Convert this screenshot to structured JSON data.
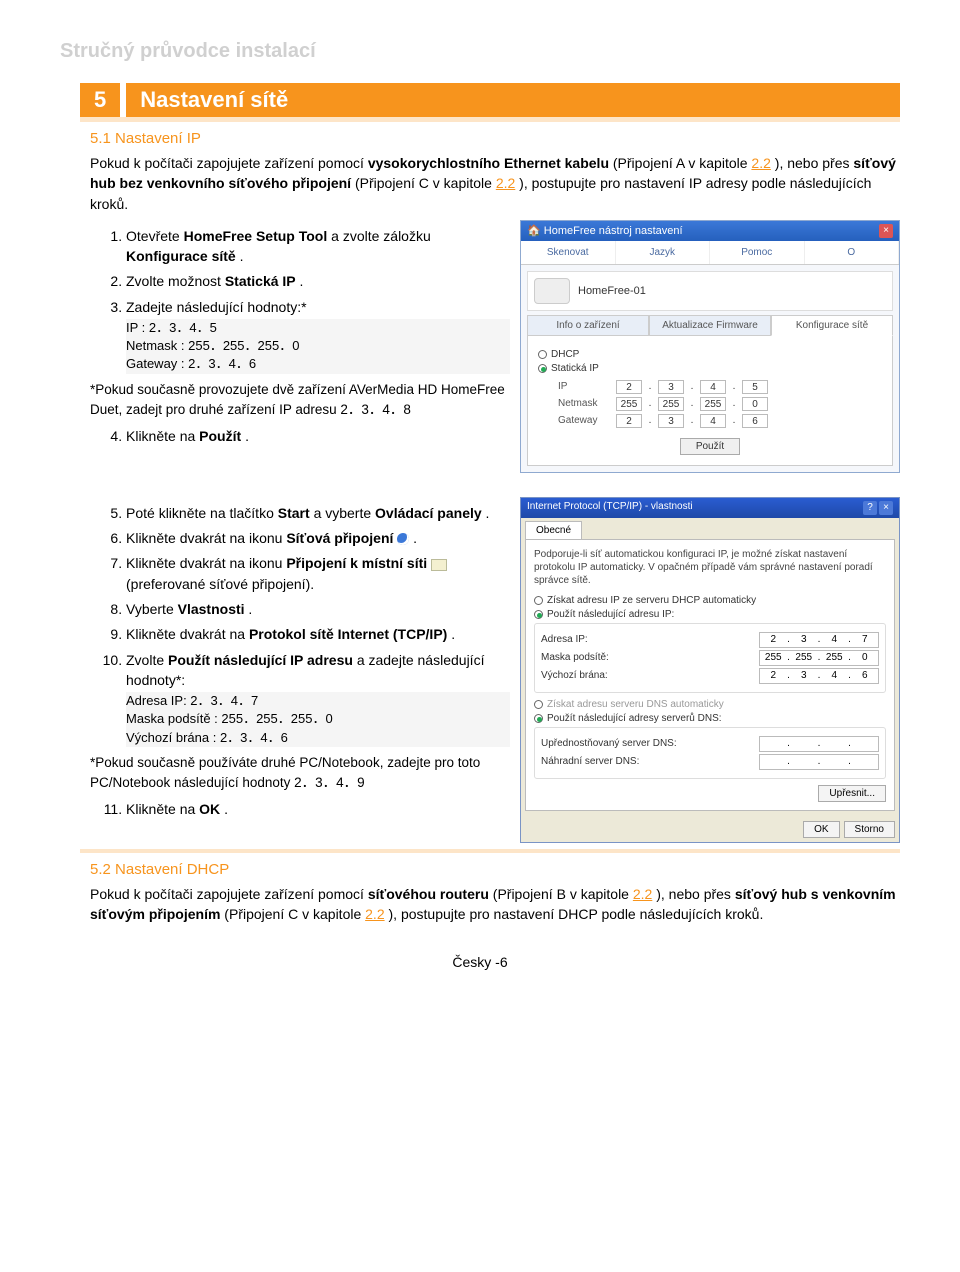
{
  "doc_title": "Stručný průvodce instalací",
  "section": {
    "num": "5",
    "title": "Nastavení sítě"
  },
  "sub_51": "5.1 Nastavení IP",
  "intro_51": {
    "p1a": "Pokud k počítači zapojujete zařízení pomocí ",
    "p1b": "vysokorychlostního Ethernet kabelu",
    "p1c": " (Připojení A v kapitole ",
    "link1": "2.2",
    "p1d": "), nebo přes ",
    "p1e": "síťový hub bez venkovního síťového připojení",
    "p1f": " (Připojení C v kapitole ",
    "link2": "2.2",
    "p1g": "), postupujte pro nastavení IP adresy podle následujících kroků."
  },
  "steps_a": {
    "s1a": "Otevřete ",
    "s1b": "HomeFree Setup Tool",
    "s1c": " a zvolte záložku ",
    "s1d": "Konfigurace sítě",
    "s1e": ".",
    "s2a": "Zvolte možnost ",
    "s2b": "Statická IP",
    "s2c": ".",
    "s3": "Zadejte následující hodnoty:*",
    "code1_l1": "IP : 2．3．4．5",
    "code1_l2": "Netmask : 255．255．255．0",
    "code1_l3": "Gateway : 2．3．4．6",
    "note1": "*Pokud současně provozujete dvě zařízení AVerMedia HD HomeFree Duet, zadejt pro druhé zařízení IP adresu 2．3．4．8",
    "s4a": "Klikněte na ",
    "s4b": "Použít",
    "s4c": "."
  },
  "steps_b": {
    "s5a": "Poté klikněte na tlačítko ",
    "s5b": "Start",
    "s5c": " a vyberte ",
    "s5d": "Ovládací panely",
    "s5e": ".",
    "s6a": "Klikněte dvakrát na ikonu ",
    "s6b": "Síťová připojení",
    "s6c": ".",
    "s7a": "Klikněte dvakrát na ikonu ",
    "s7b": "Připojení k místní síti",
    "s7c": " (preferované síťové připojení).",
    "s8a": "Vyberte ",
    "s8b": "Vlastnosti",
    "s8c": ".",
    "s9a": "Klikněte dvakrát na ",
    "s9b": "Protokol sítě Internet (TCP/IP)",
    "s9c": ".",
    "s10a": "Zvolte ",
    "s10b": "Použít následující IP adresu",
    "s10c": " a zadejte následující hodnoty*:",
    "code2_l1": "Adresa IP: 2．3．4．7",
    "code2_l2": "Maska podsítě : 255．255．255．0",
    "code2_l3": "Výchozí brána : 2．3．4．6",
    "note2": "*Pokud současně používáte druhé PC/Notebook, zadejte pro toto PC/Notebook následující hodnoty 2．3．4．9",
    "s11a": "Klikněte na ",
    "s11b": "OK",
    "s11c": "."
  },
  "sub_52": "5.2 Nastavení DHCP",
  "intro_52": {
    "t1": "Pokud k počítači zapojujete zařízení pomocí ",
    "t2": "síťovéhou routeru",
    "t3": " (Připojení B v kapitole ",
    "link3": "2.2",
    "t4": "), nebo přes ",
    "t5": "síťový hub s venkovním síťovým připojením",
    "t6": " (Připojení C v kapitole ",
    "link4": "2.2",
    "t7": "), postupujte pro nastavení DHCP podle následujících kroků."
  },
  "footer": "Česky -6",
  "shot1": {
    "title": "HomeFree nástroj nastavení",
    "tabs": [
      "Skenovat",
      "Jazyk",
      "Pomoc",
      "O"
    ],
    "device": "HomeFree-01",
    "subtabs": [
      "Info o zařízení",
      "Aktualizace Firmware",
      "Konfigurace sítě"
    ],
    "r_dhcp": "DHCP",
    "r_static": "Statická IP",
    "lbl_ip": "IP",
    "lbl_nm": "Netmask",
    "lbl_gw": "Gateway",
    "ip": [
      "2",
      "3",
      "4",
      "5"
    ],
    "nm": [
      "255",
      "255",
      "255",
      "0"
    ],
    "gw": [
      "2",
      "3",
      "4",
      "6"
    ],
    "apply": "Použít"
  },
  "shot2": {
    "title": "Internet Protocol (TCP/IP) - vlastnosti",
    "tab": "Obecné",
    "desc": "Podporuje-li síť automatickou konfiguraci IP, je možné získat nastavení protokolu IP automaticky. V opačném případě vám správné nastavení poradí správce sítě.",
    "r1": "Získat adresu IP ze serveru DHCP automaticky",
    "r2": "Použít následující adresu IP:",
    "lbl_ip": "Adresa IP:",
    "lbl_mask": "Maska podsítě:",
    "lbl_gw": "Výchozí brána:",
    "ip": [
      "2",
      "3",
      "4",
      "7"
    ],
    "mask": [
      "255",
      "255",
      "255",
      "0"
    ],
    "gw": [
      "2",
      "3",
      "4",
      "6"
    ],
    "r3": "Získat adresu serveru DNS automaticky",
    "r4": "Použít následující adresy serverů DNS:",
    "lbl_dns1": "Upřednostňovaný server DNS:",
    "lbl_dns2": "Náhradní server DNS:",
    "btn_adv": "Upřesnit...",
    "btn_ok": "OK",
    "btn_cancel": "Storno"
  }
}
